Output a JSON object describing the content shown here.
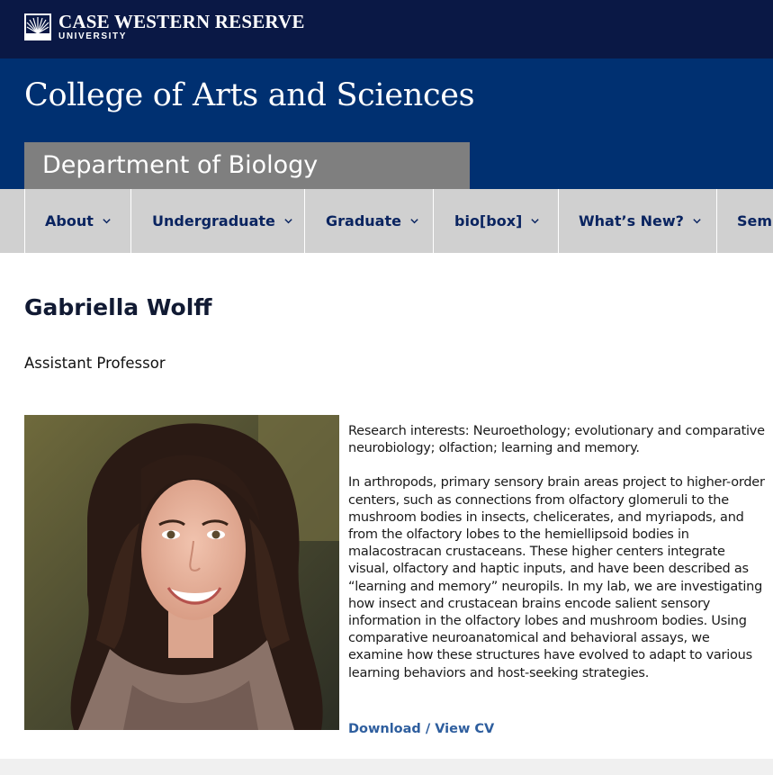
{
  "header": {
    "university_line1": "CASE WESTERN RESERVE",
    "university_line2": "UNIVERSITY",
    "logo_icon": "sunburst-icon",
    "college_title": "College of Arts and Sciences",
    "department_title": "Department of Biology"
  },
  "nav": {
    "items": [
      {
        "label": "About",
        "icon": "chevron-down-icon"
      },
      {
        "label": "Undergraduate",
        "icon": "chevron-down-icon"
      },
      {
        "label": "Graduate",
        "icon": "chevron-down-icon"
      },
      {
        "label": "bio[box]",
        "icon": "chevron-down-icon"
      },
      {
        "label": "What’s New?",
        "icon": "chevron-down-icon"
      },
      {
        "label": "Semi",
        "icon": ""
      }
    ]
  },
  "profile": {
    "name": "Gabriella Wolff",
    "title": "Assistant Professor",
    "research_interests": "Research interests: Neuroethology; evolutionary and comparative neurobiology; olfaction; learning and memory.",
    "bio": "In arthropods, primary sensory brain areas project to higher-order centers, such as connections from olfactory glomeruli to the mushroom bodies in insects, chelicerates, and myriapods, and from the olfactory lobes to the hemiellipsoid bodies in malacostracan crustaceans. These higher centers integrate visual, olfactory and haptic inputs, and have been described as “learning and memory” neuropils. In my lab, we are investigating how insect and crustacean brains encode salient sensory information in the olfactory lobes and mushroom bodies. Using comparative neuroanatomical and behavioral assays, we examine how these structures have evolved to adapt to various learning behaviors and host-seeking strategies.",
    "cv_link": "Download / View CV"
  },
  "colors": {
    "topbar": "#0a1845",
    "hero": "#003071",
    "dept_tab": "#7f7f7f",
    "nav_bg": "#d0d0d0",
    "nav_text": "#0a2460",
    "link": "#2e5e9e"
  }
}
